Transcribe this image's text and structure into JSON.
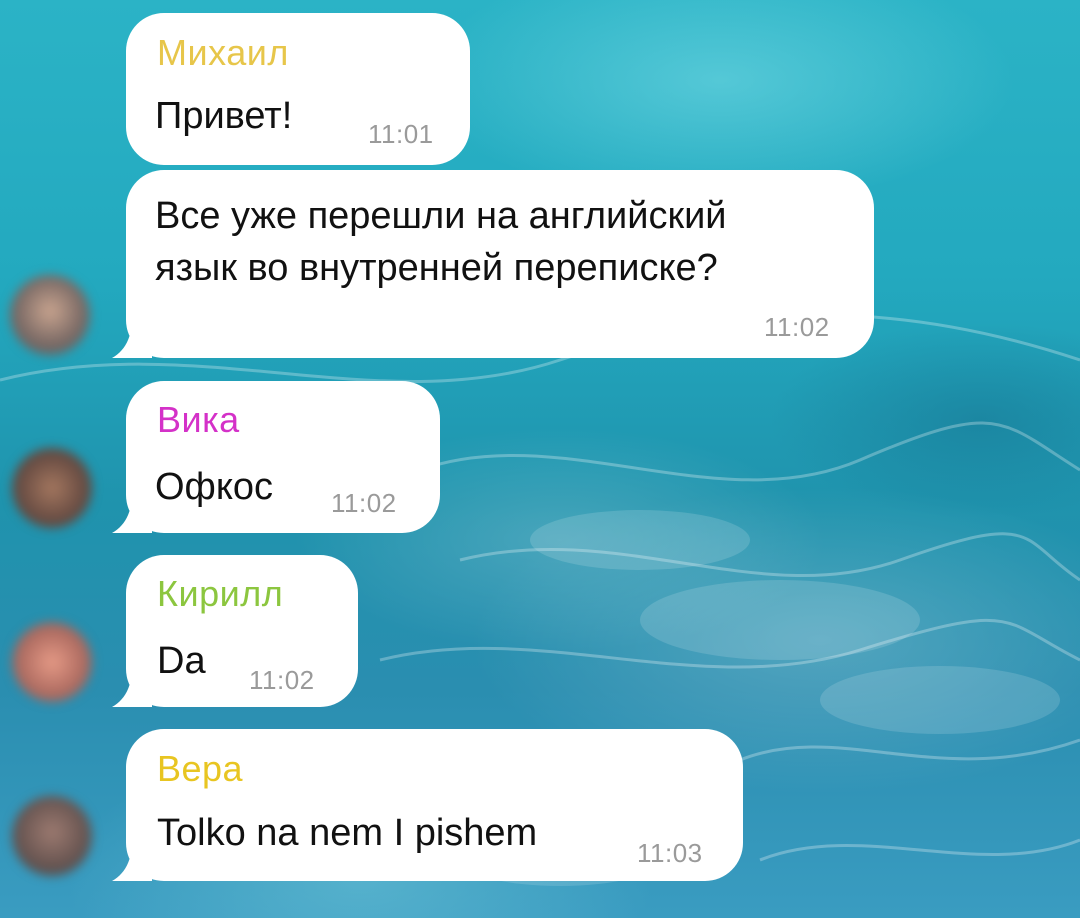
{
  "chat": {
    "messages": [
      {
        "sender": "Михаил",
        "sender_color": "#e7c64a",
        "text": "Привет!",
        "time": "11:01"
      },
      {
        "sender": "",
        "text_line1": "Все уже перешли на английский",
        "text_line2": "язык во внутренней переписке?",
        "time": "11:02"
      },
      {
        "sender": "Вика",
        "sender_color": "#d431c8",
        "text": "Офкос",
        "time": "11:02"
      },
      {
        "sender": "Кирилл",
        "sender_color": "#8cc63f",
        "text": "Da",
        "time": "11:02"
      },
      {
        "sender": "Вера",
        "sender_color": "#e8c521",
        "text": "Tolko na nem I pishem",
        "time": "11:03"
      }
    ],
    "avatars": [
      {
        "icon": "avatar-blurred"
      },
      {
        "icon": "avatar-blurred"
      },
      {
        "icon": "avatar-blurred"
      },
      {
        "icon": "avatar-blurred"
      }
    ],
    "colors": {
      "bubble": "#ffffff",
      "time": "#9a9a9a",
      "text": "#111111"
    }
  }
}
